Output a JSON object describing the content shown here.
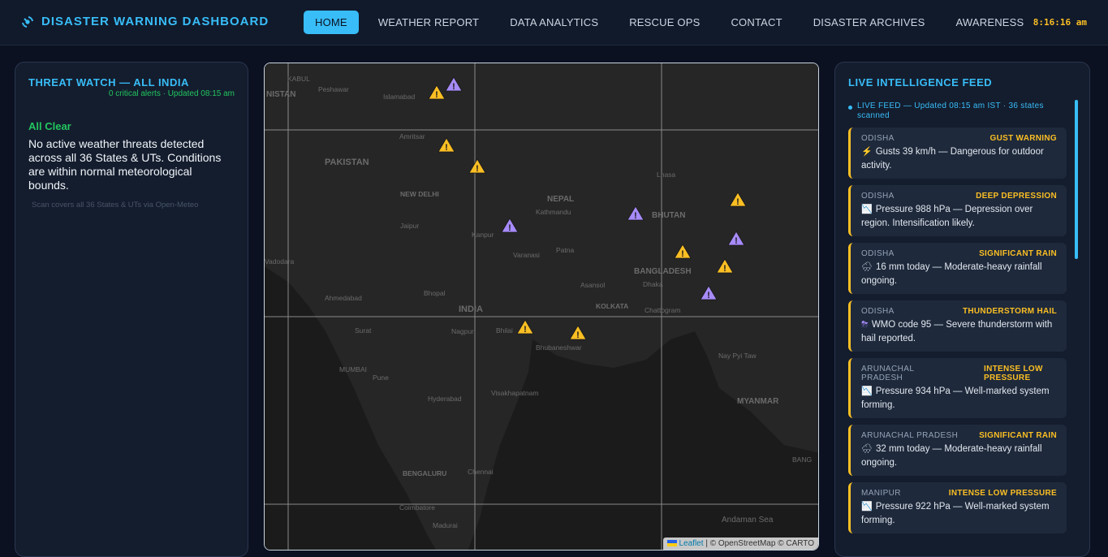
{
  "header": {
    "title": "DISASTER WARNING DASHBOARD",
    "clock": "8:16:16 am",
    "nav": [
      {
        "label": "HOME",
        "active": true
      },
      {
        "label": "WEATHER REPORT"
      },
      {
        "label": "DATA ANALYTICS"
      },
      {
        "label": "RESCUE OPS"
      },
      {
        "label": "CONTACT"
      },
      {
        "label": "DISASTER ARCHIVES"
      },
      {
        "label": "AWARENESS"
      }
    ]
  },
  "threat_watch": {
    "title": "THREAT WATCH — ALL INDIA",
    "subtitle": "0 critical alerts · Updated 08:15 am",
    "status": "All Clear",
    "message": "No active weather threats detected across all 36 States & UTs. Conditions are within normal meteorological bounds.",
    "note": "Scan covers all 36 States & UTs via Open-Meteo"
  },
  "map": {
    "labels": [
      "KABUL",
      "NISTAN",
      "Peshawar",
      "Islamabad",
      "Amritsar",
      "PAKISTAN",
      "NEW DELHI",
      "Jaipur",
      "Kanpur",
      "NEPAL",
      "Kathmandu",
      "Lhasa",
      "BHUTAN",
      "Varanasi",
      "Patna",
      "BANGLADESH",
      "Asansol",
      "Dhaka",
      "Bhopal",
      "Ahmedabad",
      "INDIA",
      "KOLKATA",
      "Chattogram",
      "Surat",
      "Nagpur",
      "Bhilai",
      "Bhubaneshwar",
      "MUMBAI",
      "Pune",
      "Nay Pyi Taw",
      "Visakhapatnam",
      "Hyderabad",
      "MYANMAR",
      "BENGALURU",
      "Chennai",
      "Coimbatore",
      "Madurai",
      "Andaman Sea",
      "Vadodara",
      "BANG"
    ],
    "attribution_link": "Leaflet",
    "attribution_text": "| © OpenStreetMap © CARTO",
    "markers": [
      {
        "color": "#fbbf24"
      },
      {
        "color": "#a78bfa"
      },
      {
        "color": "#fbbf24"
      },
      {
        "color": "#fbbf24"
      },
      {
        "color": "#a78bfa"
      },
      {
        "color": "#a78bfa"
      },
      {
        "color": "#fbbf24"
      },
      {
        "color": "#a78bfa"
      },
      {
        "color": "#fbbf24"
      },
      {
        "color": "#fbbf24"
      },
      {
        "color": "#a78bfa"
      },
      {
        "color": "#fbbf24"
      },
      {
        "color": "#fbbf24"
      }
    ]
  },
  "feed": {
    "title": "LIVE INTELLIGENCE FEED",
    "live_text": "LIVE FEED — Updated 08:15 am IST · 36 states scanned",
    "cards": [
      {
        "region": "ODISHA",
        "type": "GUST WARNING",
        "emoji": "⚡",
        "emoji_color": "#f97316",
        "message": "Gusts 39 km/h — Dangerous for outdoor activity."
      },
      {
        "region": "ODISHA",
        "type": "DEEP DEPRESSION",
        "emoji": "📉",
        "emoji_color": "#f87171",
        "message": "Pressure 988 hPa — Depression over region. Intensification likely."
      },
      {
        "region": "ODISHA",
        "type": "SIGNIFICANT RAIN",
        "emoji": "🌧",
        "emoji_color": "#cbd5e1",
        "message": "16 mm today — Moderate-heavy rainfall ongoing."
      },
      {
        "region": "ODISHA",
        "type": "THUNDERSTORM HAIL",
        "emoji": "⛈",
        "emoji_color": "#a78bfa",
        "message": "WMO code 95 — Severe thunderstorm with hail reported."
      },
      {
        "region": "ARUNACHAL PRADESH",
        "type": "INTENSE LOW PRESSURE",
        "emoji": "📉",
        "emoji_color": "#f87171",
        "message": "Pressure 934 hPa — Well-marked system forming."
      },
      {
        "region": "ARUNACHAL PRADESH",
        "type": "SIGNIFICANT RAIN",
        "emoji": "🌧",
        "emoji_color": "#cbd5e1",
        "message": "32 mm today — Moderate-heavy rainfall ongoing."
      },
      {
        "region": "MANIPUR",
        "type": "INTENSE LOW PRESSURE",
        "emoji": "📉",
        "emoji_color": "#f87171",
        "message": "Pressure 922 hPa — Well-marked system forming."
      }
    ]
  }
}
